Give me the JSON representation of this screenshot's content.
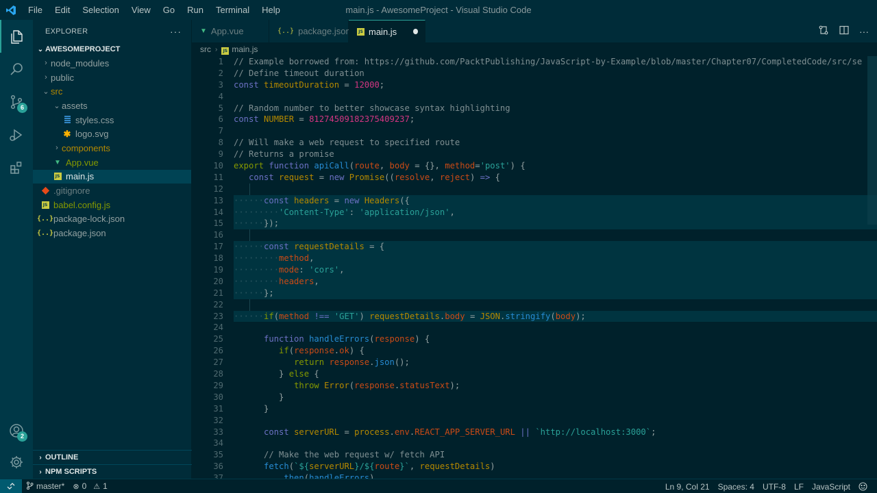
{
  "window": {
    "title": "main.js - AwesomeProject - Visual Studio Code"
  },
  "menu": [
    "File",
    "Edit",
    "Selection",
    "View",
    "Go",
    "Run",
    "Terminal",
    "Help"
  ],
  "activity": {
    "source_control_badge": "6",
    "accounts_badge": "2"
  },
  "explorer": {
    "header": "EXPLORER",
    "more": "···",
    "project": "AWESOMEPROJECT",
    "tree": {
      "node_modules": "node_modules",
      "public": "public",
      "src": "src",
      "assets": "assets",
      "styles_css": "styles.css",
      "logo_svg": "logo.svg",
      "components": "components",
      "app_vue": "App.vue",
      "main_js": "main.js",
      "gitignore": ".gitignore",
      "babel_config": "babel.config.js",
      "package_lock": "package-lock.json",
      "package_json": "package.json"
    },
    "outline": "OUTLINE",
    "npm_scripts": "NPM SCRIPTS"
  },
  "tabs": [
    {
      "label": "App.vue",
      "icon": "vue-icon"
    },
    {
      "label": "package.json",
      "icon": "json-icon"
    },
    {
      "label": "main.js",
      "icon": "js-icon",
      "active": true,
      "dirty": true
    }
  ],
  "breadcrumb": {
    "folder": "src",
    "file": "main.js"
  },
  "editor": {
    "lines": [
      "1",
      "2",
      "3",
      "4",
      "5",
      "6",
      "7",
      "8",
      "9",
      "10",
      "11",
      "12",
      "13",
      "14",
      "15",
      "16",
      "17",
      "18",
      "19",
      "20",
      "21",
      "22",
      "23",
      "24",
      "25",
      "26",
      "27",
      "28",
      "29",
      "30",
      "31",
      "32",
      "33",
      "34",
      "35",
      "36",
      "37"
    ],
    "comment1": "// Example borrowed from: https://github.com/PacktPublishing/JavaScript-by-Example/blob/master/Chapter07/CompletedCode/src/se",
    "comment2": "// Define timeout duration",
    "comment3": "// Random number to better showcase syntax highlighting",
    "comment4": "// Will make a web request to specified route",
    "comment5": "// Returns a promise",
    "comment6": "// Make the web request w/ fetch API",
    "timeout": "12000",
    "number": "81274509182375409237",
    "content_type": "'Content-Type'",
    "app_json": "'application/json'",
    "cors": "'cors'",
    "get": "'GET'",
    "post": "'post'",
    "localhost": "`http://localhost:3000`"
  },
  "status": {
    "branch": "master*",
    "errors": "0",
    "warnings": "1",
    "position": "Ln 9, Col 21",
    "spaces": "Spaces: 4",
    "encoding": "UTF-8",
    "eol": "LF",
    "language": "JavaScript"
  },
  "colors": {
    "accent": "#2aa198",
    "background": "#00212b",
    "sidebar": "#002c39"
  }
}
